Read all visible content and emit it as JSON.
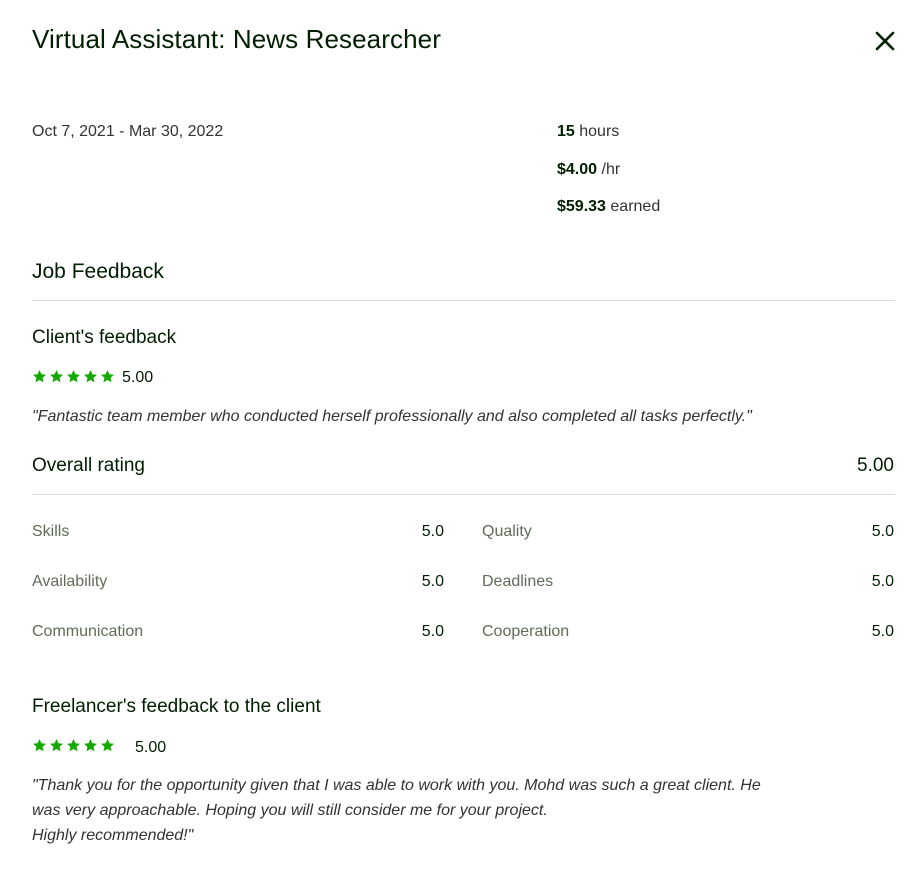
{
  "header": {
    "title": "Virtual Assistant: News Researcher"
  },
  "job": {
    "date_range": "Oct 7, 2021 - Mar 30, 2022",
    "hours_value": "15",
    "hours_unit": "hours",
    "rate_value": "$4.00",
    "rate_unit": "/hr",
    "earned_value": "$59.33",
    "earned_unit": "earned"
  },
  "job_feedback": {
    "heading": "Job Feedback"
  },
  "client_feedback": {
    "heading": "Client's feedback",
    "stars": 5,
    "score": "5.00",
    "quote": "\"Fantastic team member who conducted herself professionally and also completed all tasks perfectly.\""
  },
  "overall": {
    "label": "Overall rating",
    "value": "5.00"
  },
  "categories": [
    {
      "label": "Skills",
      "value": "5.0"
    },
    {
      "label": "Quality",
      "value": "5.0"
    },
    {
      "label": "Availability",
      "value": "5.0"
    },
    {
      "label": "Deadlines",
      "value": "5.0"
    },
    {
      "label": "Communication",
      "value": "5.0"
    },
    {
      "label": "Cooperation",
      "value": "5.0"
    }
  ],
  "freelancer_feedback": {
    "heading": "Freelancer's feedback to the client",
    "stars": 5,
    "score": "5.00",
    "quote_lines": [
      "\"Thank you for the opportunity given that I was able to work with you. Mohd was such a great client. He",
      "was very approachable. Hoping you will still consider me for your project.",
      "Highly recommended!\""
    ]
  },
  "colors": {
    "star": "#14a800",
    "text": "#001e00",
    "muted": "#5e6d55",
    "divider": "#d5e0d5"
  },
  "icons": {
    "close": "close-icon",
    "star": "star-icon"
  }
}
